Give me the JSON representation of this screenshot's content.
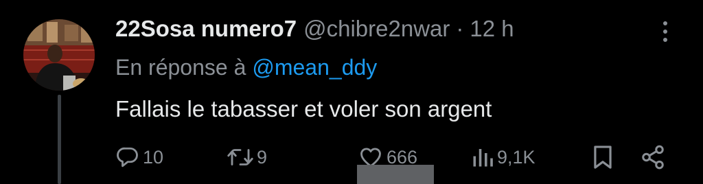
{
  "tweet": {
    "display_name": "22Sosa numero7",
    "handle": "@chibre2nwar",
    "separator": "·",
    "time": "12 h",
    "reply_prefix": "En réponse à",
    "reply_mention": "@mean_ddy",
    "text": "Fallais le tabasser et voler son argent"
  },
  "actions": {
    "replies": "10",
    "reposts": "9",
    "likes": "666",
    "views": "9,1K"
  },
  "icons": {
    "reply": "speech-bubble-icon",
    "repost": "repost-arrows-icon",
    "like": "heart-icon",
    "views": "bar-chart-icon",
    "bookmark": "bookmark-icon",
    "share": "share-nodes-icon",
    "more": "vertical-ellipsis-icon"
  },
  "colors": {
    "background": "#000000",
    "primary_text": "#e7e9ea",
    "secondary_text": "#8b9096",
    "link": "#1d9bf0"
  }
}
